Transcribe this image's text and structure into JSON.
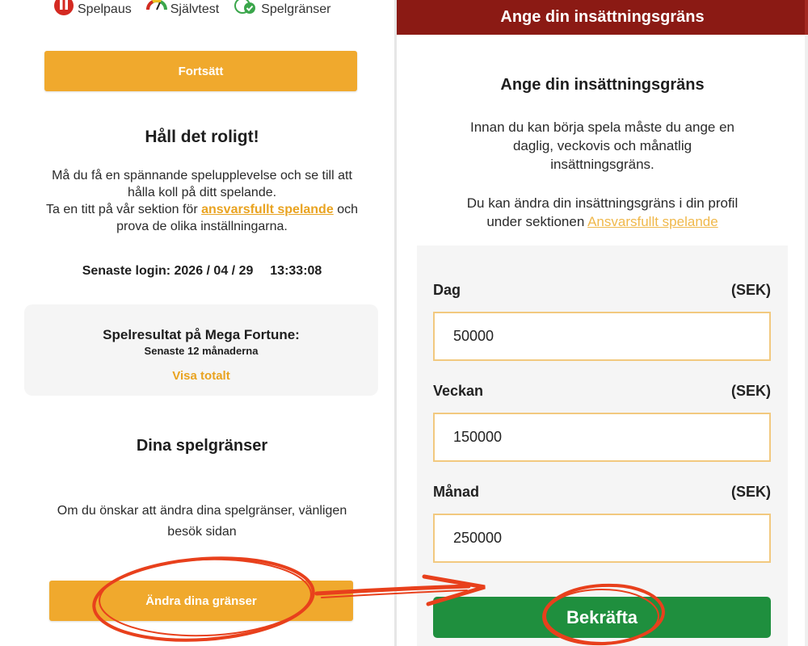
{
  "left": {
    "top_icons": [
      {
        "icon": "pause-icon",
        "label": "Spelpaus"
      },
      {
        "icon": "gauge-icon",
        "label": "Självtest"
      },
      {
        "icon": "limits-icon",
        "label": "Spelgränser"
      }
    ],
    "continue_button": "Fortsätt",
    "heading": "Håll det roligt!",
    "intro_line1": "Må du få en spännande spelupplevelse och se till att",
    "intro_line2": "hålla koll på ditt spelande.",
    "intro_line3_pre": "Ta en titt på vår sektion för",
    "intro_link": "ansvarsfullt spelande",
    "intro_line3_post": "och",
    "intro_line4": "prova de olika inställningarna.",
    "last_login_label": "Senaste login:",
    "last_login_date": "2026 / 04 / 29",
    "last_login_time": "13:33:08",
    "results_card": {
      "title": "Spelresultat på Mega Fortune:",
      "subtitle": "Senaste 12 månaderna",
      "link": "Visa totalt"
    },
    "limits_heading": "Dina spelgränser",
    "limits_text_line1": "Om du önskar att ändra dina spelgränser, vänligen",
    "limits_text_line2": "besök sidan",
    "change_limits_button": "Ändra dina gränser"
  },
  "right": {
    "header_title": "Ange din insättningsgräns",
    "section_title": "Ange din insättningsgräns",
    "desc_line1": "Innan du kan börja spela måste du ange en",
    "desc_line2": "daglig, veckovis och månatlig",
    "desc_line3": "insättningsgräns.",
    "profile_line1": "Du kan ändra din insättningsgräns i din profil",
    "profile_line2_pre": "under sektionen",
    "profile_link": "Ansvarsfullt spelande",
    "fields": [
      {
        "label": "Dag",
        "unit": "(SEK)",
        "value": "50000"
      },
      {
        "label": "Veckan",
        "unit": "(SEK)",
        "value": "150000"
      },
      {
        "label": "Månad",
        "unit": "(SEK)",
        "value": "250000"
      }
    ],
    "confirm_button": "Bekräfta"
  },
  "colors": {
    "header_red": "#8b1a14",
    "button_orange": "#f0a92d",
    "button_green": "#1f8f3e",
    "link_orange": "#e9a320",
    "annotation_red": "#e8401c"
  }
}
